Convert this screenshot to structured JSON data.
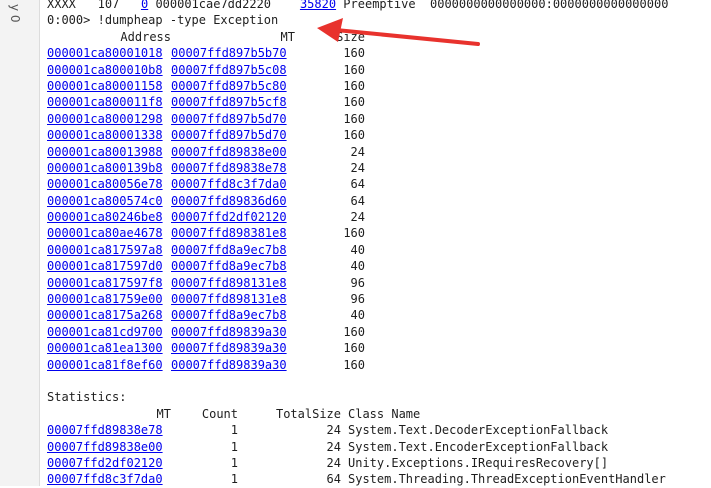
{
  "gutter_label": "y 0",
  "top_row": {
    "thread_name": "XXXX",
    "id": "107",
    "osid_link": "0",
    "thread_obj": "000001cae7dd2220",
    "state_link": "35820",
    "gc_mode": "Preemptive",
    "alloc_range": "0000000000000000:0000000000000000"
  },
  "command": {
    "prompt": "0:000>",
    "text": "!dumpheap -type Exception"
  },
  "dump_headers": {
    "address": "Address",
    "mt": "MT",
    "size": "Size"
  },
  "dump_rows": [
    {
      "address": "000001ca80001018",
      "mt": "00007ffd897b5b70",
      "size": "160"
    },
    {
      "address": "000001ca800010b8",
      "mt": "00007ffd897b5c08",
      "size": "160"
    },
    {
      "address": "000001ca80001158",
      "mt": "00007ffd897b5c80",
      "size": "160"
    },
    {
      "address": "000001ca800011f8",
      "mt": "00007ffd897b5cf8",
      "size": "160"
    },
    {
      "address": "000001ca80001298",
      "mt": "00007ffd897b5d70",
      "size": "160"
    },
    {
      "address": "000001ca80001338",
      "mt": "00007ffd897b5d70",
      "size": "160"
    },
    {
      "address": "000001ca80013988",
      "mt": "00007ffd89838e00",
      "size": "24"
    },
    {
      "address": "000001ca800139b8",
      "mt": "00007ffd89838e78",
      "size": "24"
    },
    {
      "address": "000001ca80056e78",
      "mt": "00007ffd8c3f7da0",
      "size": "64"
    },
    {
      "address": "000001ca800574c0",
      "mt": "00007ffd89836d60",
      "size": "64"
    },
    {
      "address": "000001ca80246be8",
      "mt": "00007ffd2df02120",
      "size": "24"
    },
    {
      "address": "000001ca80ae4678",
      "mt": "00007ffd898381e8",
      "size": "160"
    },
    {
      "address": "000001ca817597a8",
      "mt": "00007ffd8a9ec7b8",
      "size": "40"
    },
    {
      "address": "000001ca817597d0",
      "mt": "00007ffd8a9ec7b8",
      "size": "40"
    },
    {
      "address": "000001ca817597f8",
      "mt": "00007ffd898131e8",
      "size": "96"
    },
    {
      "address": "000001ca81759e00",
      "mt": "00007ffd898131e8",
      "size": "96"
    },
    {
      "address": "000001ca8175a268",
      "mt": "00007ffd8a9ec7b8",
      "size": "40"
    },
    {
      "address": "000001ca81cd9700",
      "mt": "00007ffd89839a30",
      "size": "160"
    },
    {
      "address": "000001ca81ea1300",
      "mt": "00007ffd89839a30",
      "size": "160"
    },
    {
      "address": "000001ca81f8ef60",
      "mt": "00007ffd89839a30",
      "size": "160"
    }
  ],
  "statistics": {
    "title": "Statistics:",
    "headers": {
      "mt": "MT",
      "count": "Count",
      "total": "TotalSize",
      "class": "Class Name"
    },
    "rows": [
      {
        "mt": "00007ffd89838e78",
        "count": "1",
        "total": "24",
        "class": "System.Text.DecoderExceptionFallback"
      },
      {
        "mt": "00007ffd89838e00",
        "count": "1",
        "total": "24",
        "class": "System.Text.EncoderExceptionFallback"
      },
      {
        "mt": "00007ffd2df02120",
        "count": "1",
        "total": "24",
        "class": "Unity.Exceptions.IRequiresRecovery[]"
      },
      {
        "mt": "00007ffd8c3f7da0",
        "count": "1",
        "total": "64",
        "class": "System.Threading.ThreadExceptionEventHandler"
      }
    ]
  },
  "annotation": {
    "arrow_color": "#e8322d"
  }
}
